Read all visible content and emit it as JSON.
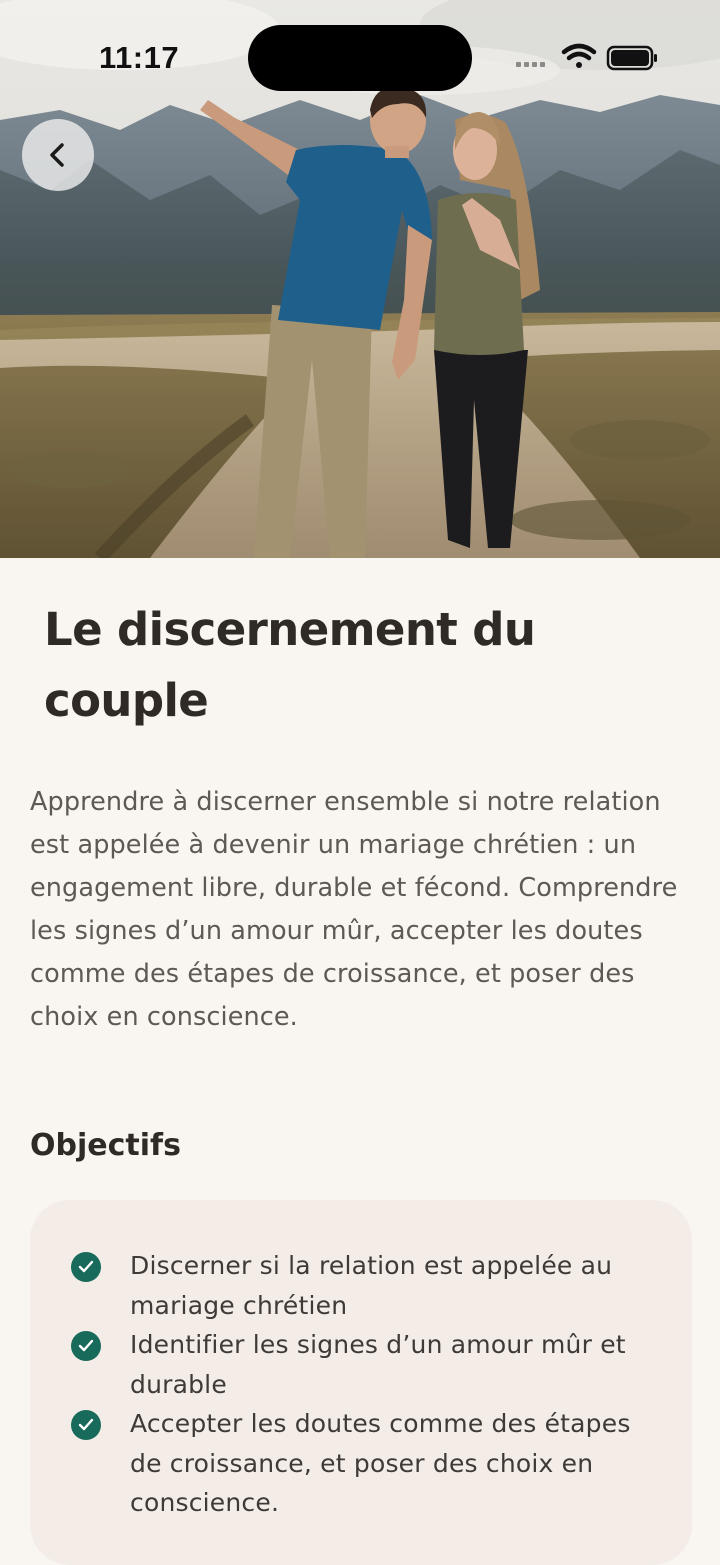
{
  "status_bar": {
    "time": "11:17",
    "icons": [
      "signal-icon",
      "wifi-icon",
      "battery-icon"
    ]
  },
  "navigation": {
    "back_icon": "chevron-left-icon"
  },
  "hero": {
    "image": "couple-on-mountain-path-photo"
  },
  "course": {
    "title": "Le discernement du couple",
    "description": "Apprendre à discerner ensemble si notre relation est appelée à devenir un mariage chrétien : un engagement libre, durable et fécond. Comprendre les signes d’un amour mûr, accepter les doutes comme des étapes de croissance, et poser des choix en conscience."
  },
  "objectives": {
    "heading": "Objectifs",
    "items": [
      "Discerner si la relation est appelée au mariage chrétien",
      "Identifier les signes d’un amour mûr et durable",
      "Accepter les doutes comme des étapes de croissance, et poser des choix en conscience."
    ],
    "icon": "check-circle-icon"
  },
  "colors": {
    "background": "#f9f5f1",
    "card": "#f4ede7",
    "accent": "#186a5a",
    "text_primary": "#2f2a26",
    "text_secondary": "#5d5954"
  }
}
